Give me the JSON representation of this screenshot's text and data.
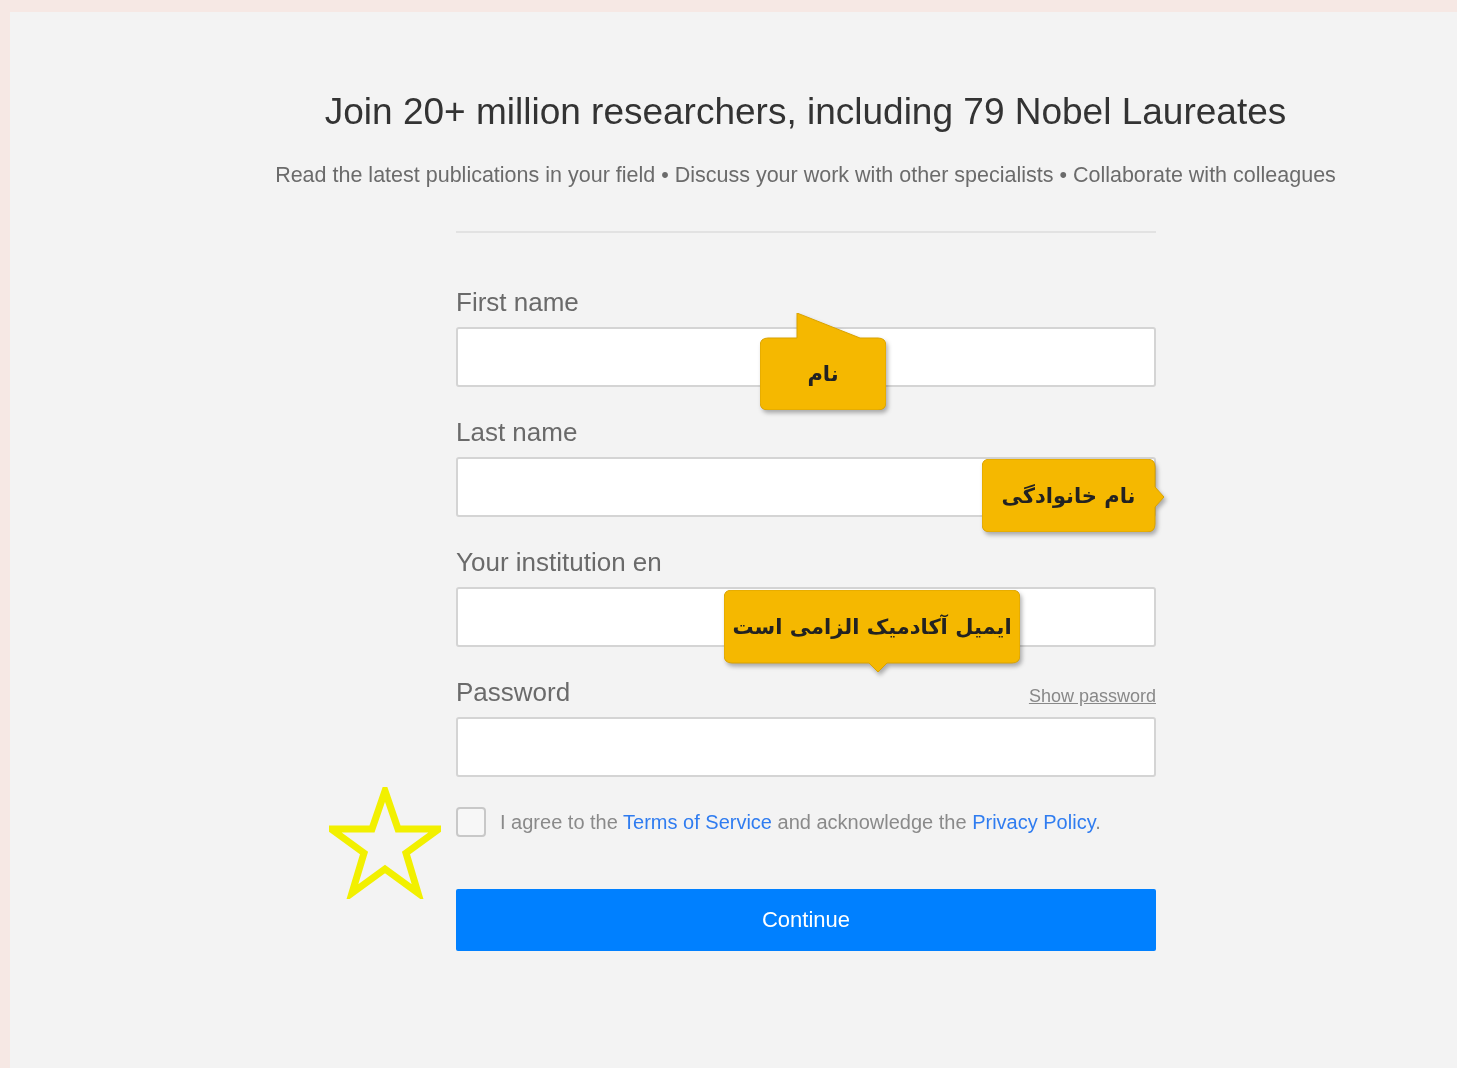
{
  "headline": "Join 20+ million researchers, including 79 Nobel Laureates",
  "subtitle": "Read the latest publications in your field • Discuss your work with other specialists • Collaborate with colleagues",
  "fields": [
    {
      "label": "First name"
    },
    {
      "label": "Last name"
    },
    {
      "label": "Your institution en"
    },
    {
      "label": "Password",
      "action": "Show password"
    }
  ],
  "agreement": {
    "checked": false,
    "parts": [
      {
        "kind": "text",
        "text": "I agree to the "
      },
      {
        "kind": "link",
        "text": "Terms of Service"
      },
      {
        "kind": "text",
        "text": " and acknowledge the "
      },
      {
        "kind": "link",
        "text": "Privacy Policy"
      },
      {
        "kind": "text",
        "text": "."
      }
    ]
  },
  "button": "Continue",
  "callouts": [
    {
      "text": "نام",
      "kind": "top"
    },
    {
      "text": "نام خانوادگی",
      "kind": "right"
    },
    {
      "text": "ایمیل آکادمیک الزامی است",
      "kind": "bottom"
    }
  ]
}
